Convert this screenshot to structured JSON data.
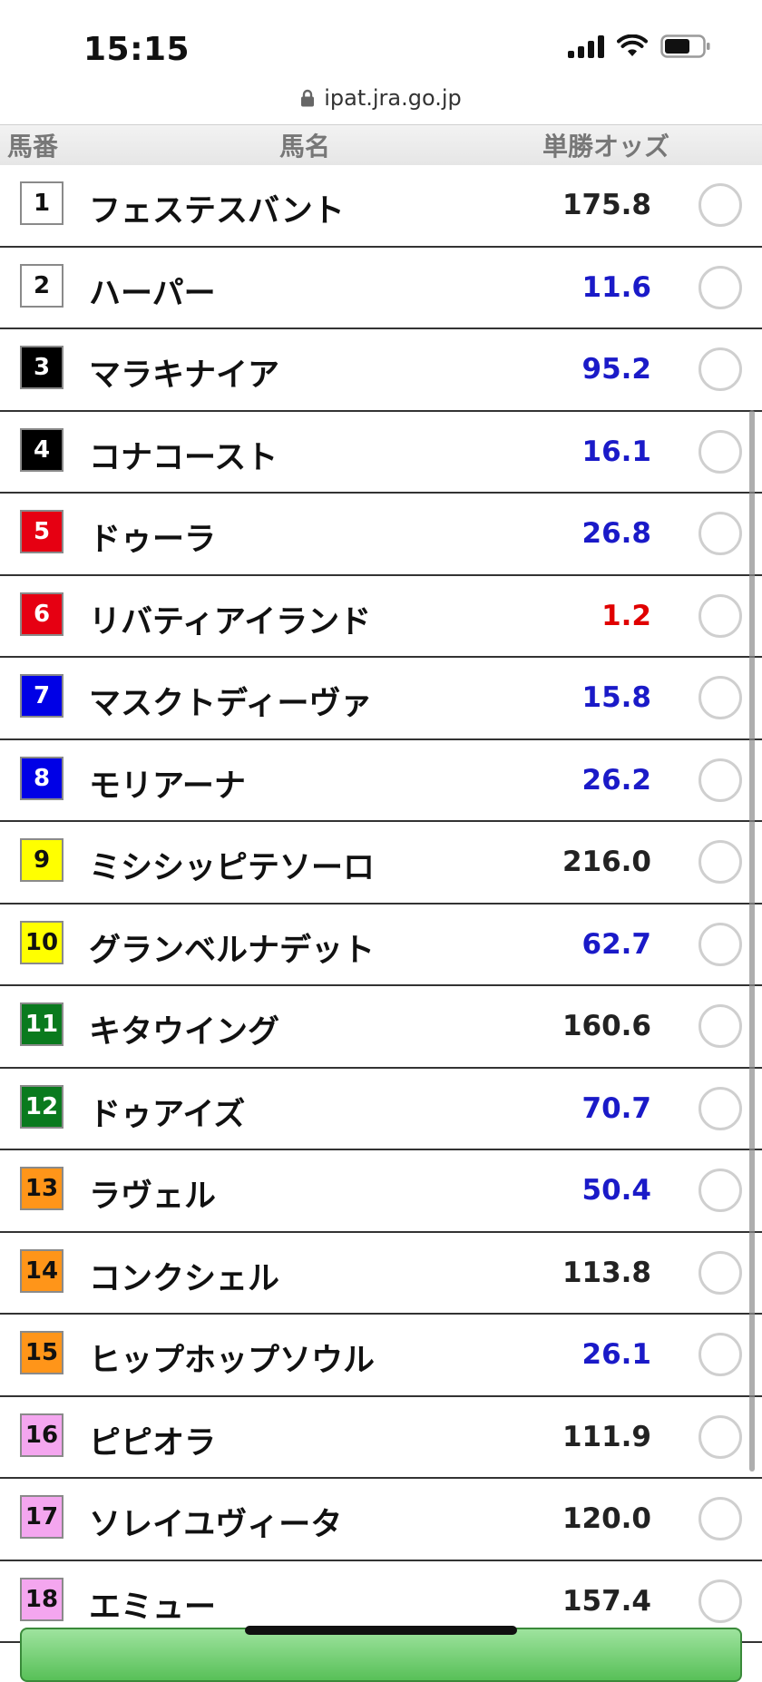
{
  "status_bar": {
    "time": "15:15"
  },
  "browser": {
    "url": "ipat.jra.go.jp"
  },
  "table": {
    "headers": {
      "number": "馬番",
      "name": "馬名",
      "odds": "単勝オッズ"
    },
    "rows": [
      {
        "number": "1",
        "name": "フェステスバント",
        "odds": "175.8",
        "frame_color": "#ffffff",
        "num_color": "#111111",
        "odds_color": "#222222"
      },
      {
        "number": "2",
        "name": "ハーパー",
        "odds": "11.6",
        "frame_color": "#ffffff",
        "num_color": "#111111",
        "odds_color": "#1a1ac8"
      },
      {
        "number": "3",
        "name": "マラキナイア",
        "odds": "95.2",
        "frame_color": "#000000",
        "num_color": "#ffffff",
        "odds_color": "#1a1ac8"
      },
      {
        "number": "4",
        "name": "コナコースト",
        "odds": "16.1",
        "frame_color": "#000000",
        "num_color": "#ffffff",
        "odds_color": "#1a1ac8"
      },
      {
        "number": "5",
        "name": "ドゥーラ",
        "odds": "26.8",
        "frame_color": "#e60012",
        "num_color": "#ffffff",
        "odds_color": "#1a1ac8"
      },
      {
        "number": "6",
        "name": "リバティアイランド",
        "odds": "1.2",
        "frame_color": "#e60012",
        "num_color": "#ffffff",
        "odds_color": "#e00000"
      },
      {
        "number": "7",
        "name": "マスクトディーヴァ",
        "odds": "15.8",
        "frame_color": "#0000e6",
        "num_color": "#ffffff",
        "odds_color": "#1a1ac8"
      },
      {
        "number": "8",
        "name": "モリアーナ",
        "odds": "26.2",
        "frame_color": "#0000e6",
        "num_color": "#ffffff",
        "odds_color": "#1a1ac8"
      },
      {
        "number": "9",
        "name": "ミシシッピテソーロ",
        "odds": "216.0",
        "frame_color": "#ffff00",
        "num_color": "#111111",
        "odds_color": "#222222"
      },
      {
        "number": "10",
        "name": "グランベルナデット",
        "odds": "62.7",
        "frame_color": "#ffff00",
        "num_color": "#111111",
        "odds_color": "#1a1ac8"
      },
      {
        "number": "11",
        "name": "キタウイング",
        "odds": "160.6",
        "frame_color": "#0a7a1e",
        "num_color": "#ffffff",
        "odds_color": "#222222"
      },
      {
        "number": "12",
        "name": "ドゥアイズ",
        "odds": "70.7",
        "frame_color": "#0a7a1e",
        "num_color": "#ffffff",
        "odds_color": "#1a1ac8"
      },
      {
        "number": "13",
        "name": "ラヴェル",
        "odds": "50.4",
        "frame_color": "#ff9519",
        "num_color": "#111111",
        "odds_color": "#1a1ac8"
      },
      {
        "number": "14",
        "name": "コンクシェル",
        "odds": "113.8",
        "frame_color": "#ff9519",
        "num_color": "#111111",
        "odds_color": "#222222"
      },
      {
        "number": "15",
        "name": "ヒップホップソウル",
        "odds": "26.1",
        "frame_color": "#ff9519",
        "num_color": "#111111",
        "odds_color": "#1a1ac8"
      },
      {
        "number": "16",
        "name": "ピピオラ",
        "odds": "111.9",
        "frame_color": "#f4a6ef",
        "num_color": "#111111",
        "odds_color": "#222222"
      },
      {
        "number": "17",
        "name": "ソレイユヴィータ",
        "odds": "120.0",
        "frame_color": "#f4a6ef",
        "num_color": "#111111",
        "odds_color": "#222222"
      },
      {
        "number": "18",
        "name": "エミュー",
        "odds": "157.4",
        "frame_color": "#f4a6ef",
        "num_color": "#111111",
        "odds_color": "#222222"
      }
    ]
  }
}
